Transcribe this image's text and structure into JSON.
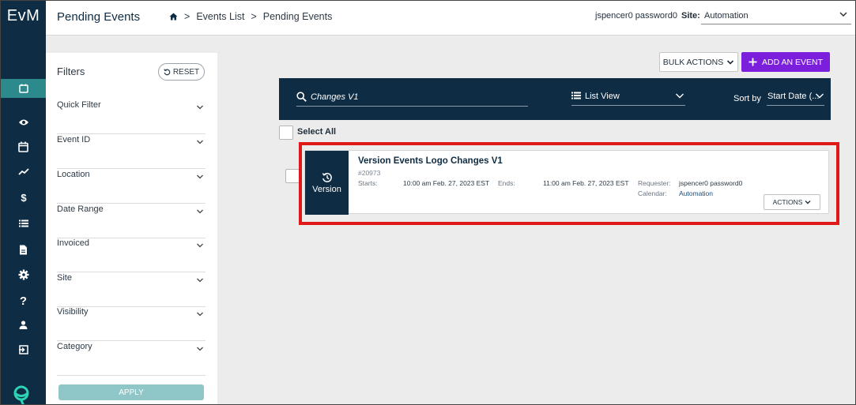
{
  "app": {
    "logo": "EvM"
  },
  "header": {
    "page_title": "Pending Events",
    "breadcrumbs": [
      "Events List",
      "Pending Events"
    ],
    "breadcrumb_sep": ">",
    "user": "jspencer0 password0",
    "site_label": "Site:",
    "site_value": "Automation"
  },
  "sidebar": {
    "icons": [
      "calendar-icon",
      "eye-icon",
      "calendar-icon",
      "trend-icon",
      "dollar-icon",
      "list-icon",
      "document-icon",
      "gear-icon",
      "question-icon",
      "user-icon",
      "logout-icon"
    ],
    "active_index": 0
  },
  "filters": {
    "title": "Filters",
    "reset_label": "RESET",
    "items": [
      "Quick Filter",
      "Event ID",
      "Location",
      "Date Range",
      "Invoiced",
      "Site",
      "Visibility",
      "Category"
    ],
    "apply_label": "APPLY"
  },
  "toolbar": {
    "bulk_actions_label": "BULK ACTIONS",
    "add_event_label": "ADD AN EVENT"
  },
  "search": {
    "value": "Changes V1",
    "view_value": "List View",
    "sort_label": "Sort by",
    "sort_value": "Start Date (..."
  },
  "list": {
    "select_all_label": "Select All",
    "events": [
      {
        "badge_label": "Version",
        "title": "Version Events Logo Changes V1",
        "id": "#20973",
        "starts_label": "Starts:",
        "starts_value": "10:00 am Feb. 27, 2023 EST",
        "ends_label": "Ends:",
        "ends_value": "11:00 am Feb. 27, 2023 EST",
        "requester_label": "Requester:",
        "requester_value": "jspencer0 password0",
        "calendar_label": "Calendar:",
        "calendar_value": "Automation",
        "actions_label": "ACTIONS"
      }
    ]
  },
  "colors": {
    "navy": "#0e2c43",
    "teal": "#2c8a8c",
    "purple": "#7b1fdc",
    "highlight": "#e01818"
  }
}
